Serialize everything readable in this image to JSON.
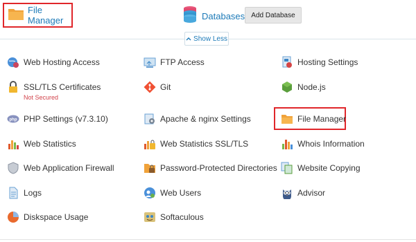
{
  "header": {
    "file_manager_label": "File Manager",
    "databases_label": "Databases",
    "add_database_label": "Add Database"
  },
  "toggle": {
    "show_less_label": "Show Less"
  },
  "tools": {
    "col1": [
      {
        "label": "Web Hosting Access",
        "icon": "globe-user-icon"
      },
      {
        "label": "SSL/TLS Certificates",
        "sublabel": "Not Secured",
        "icon": "lock-icon"
      },
      {
        "label": "PHP Settings (v7.3.10)",
        "icon": "php-icon"
      },
      {
        "label": "Web Statistics",
        "icon": "bar-chart-icon"
      },
      {
        "label": "Web Application Firewall",
        "icon": "shield-icon"
      },
      {
        "label": "Logs",
        "icon": "document-icon"
      },
      {
        "label": "Diskspace Usage",
        "icon": "pie-chart-icon"
      }
    ],
    "col2": [
      {
        "label": "FTP Access",
        "icon": "ftp-icon"
      },
      {
        "label": "Git",
        "icon": "git-icon"
      },
      {
        "label": "Apache & nginx Settings",
        "icon": "settings-page-icon"
      },
      {
        "label": "Web Statistics SSL/TLS",
        "icon": "bar-chart-lock-icon"
      },
      {
        "label": "Password-Protected Directories",
        "icon": "folder-lock-icon"
      },
      {
        "label": "Web Users",
        "icon": "users-globe-icon"
      },
      {
        "label": "Softaculous",
        "icon": "softaculous-icon"
      }
    ],
    "col3": [
      {
        "label": "Hosting Settings",
        "icon": "hosting-settings-icon"
      },
      {
        "label": "Node.js",
        "icon": "nodejs-icon"
      },
      {
        "label": "File Manager",
        "icon": "folder-icon"
      },
      {
        "label": "Whois Information",
        "icon": "whois-chart-icon"
      },
      {
        "label": "Website Copying",
        "icon": "copy-icon"
      },
      {
        "label": "Advisor",
        "icon": "owl-icon"
      }
    ]
  },
  "colors": {
    "link": "#1c7ab8",
    "highlight_border": "#e0262a",
    "warning": "#d2434b",
    "folder": "#f0a23a"
  }
}
